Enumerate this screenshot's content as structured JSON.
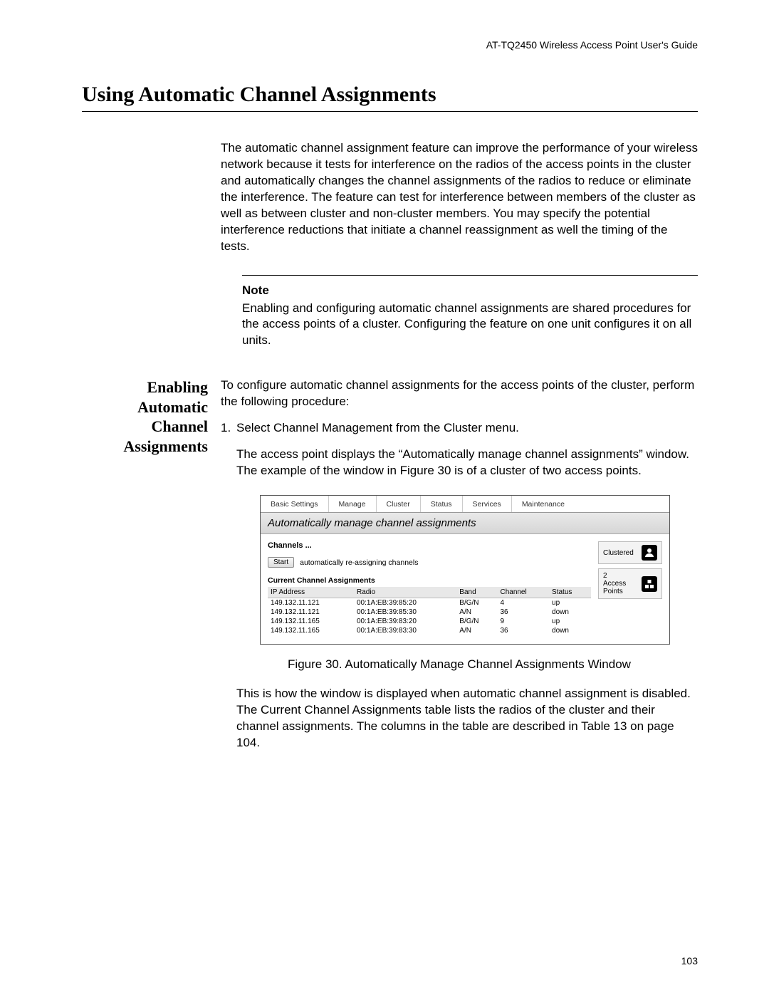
{
  "running_head": "AT-TQ2450 Wireless Access Point User's Guide",
  "section_title": "Using Automatic Channel Assignments",
  "intro_para": "The automatic channel assignment feature can improve the performance of your wireless network because it tests for interference on the radios of the access points in the cluster and automatically changes the channel assignments of the radios to reduce or eliminate the interference. The feature can test for interference between members of the cluster as well as between cluster and non-cluster members. You may specify the potential interference reductions that initiate a channel reassignment as well the timing of the tests.",
  "note": {
    "label": "Note",
    "text": "Enabling and configuring automatic channel assignments are shared procedures for the access points of a cluster. Configuring the feature on one unit configures it on all units."
  },
  "side_heading": "Enabling Automatic Channel Assignments",
  "proc_intro": "To configure automatic channel assignments for the access points of the cluster, perform the following procedure:",
  "step1_num": "1.",
  "step1_text": "Select Channel Management from the Cluster menu.",
  "step1_body": "The access point displays the “Automatically manage channel assignments” window. The example of the window in Figure 30 is of a cluster of two access points.",
  "figure": {
    "tabs": [
      "Basic Settings",
      "Manage",
      "Cluster",
      "Status",
      "Services",
      "Maintenance"
    ],
    "panel_title": "Automatically manage channel assignments",
    "channels_head": "Channels ...",
    "start_button": "Start",
    "start_label": "automatically re-assigning channels",
    "subhead": "Current Channel Assignments",
    "columns": [
      "IP Address",
      "Radio",
      "Band",
      "Channel",
      "Status"
    ],
    "rows": [
      {
        "ip": "149.132.11.121",
        "radio": "00:1A:EB:39:85:20",
        "band": "B/G/N",
        "channel": "4",
        "status": "up"
      },
      {
        "ip": "149.132.11.121",
        "radio": "00:1A:EB:39:85:30",
        "band": "A/N",
        "channel": "36",
        "status": "down"
      },
      {
        "ip": "149.132.11.165",
        "radio": "00:1A:EB:39:83:20",
        "band": "B/G/N",
        "channel": "9",
        "status": "up"
      },
      {
        "ip": "149.132.11.165",
        "radio": "00:1A:EB:39:83:30",
        "band": "A/N",
        "channel": "36",
        "status": "down"
      }
    ],
    "status1": "Clustered",
    "status2_top": "2",
    "status2_bot": "Access Points"
  },
  "fig_caption": "Figure 30. Automatically Manage Channel Assignments Window",
  "after_fig": "This is how the window is displayed when automatic channel assignment is disabled. The Current Channel Assignments table lists the radios of the cluster and their channel assignments. The columns in the table are described in Table 13 on page 104.",
  "page_number": "103"
}
